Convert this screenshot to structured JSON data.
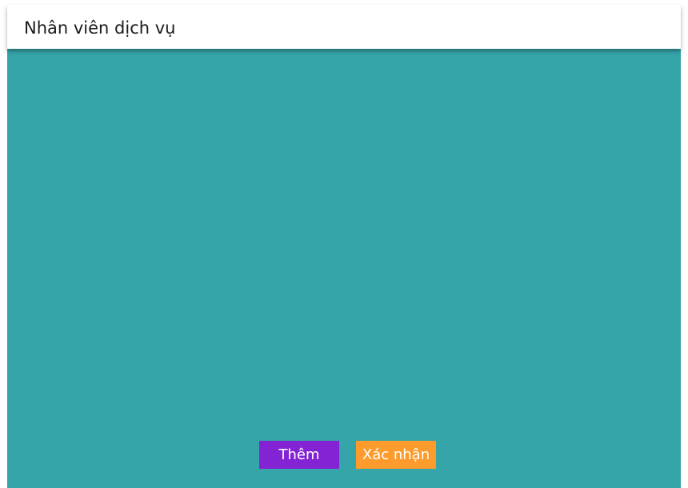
{
  "window": {
    "title": "Nhân viên dịch vụ"
  },
  "actions": {
    "add_label": "Thêm",
    "confirm_label": "Xác nhận"
  },
  "colors": {
    "background": "#35a5aa",
    "add_button": "#8323d3",
    "confirm_button": "#fd9c2c",
    "titlebar": "#ffffff"
  }
}
